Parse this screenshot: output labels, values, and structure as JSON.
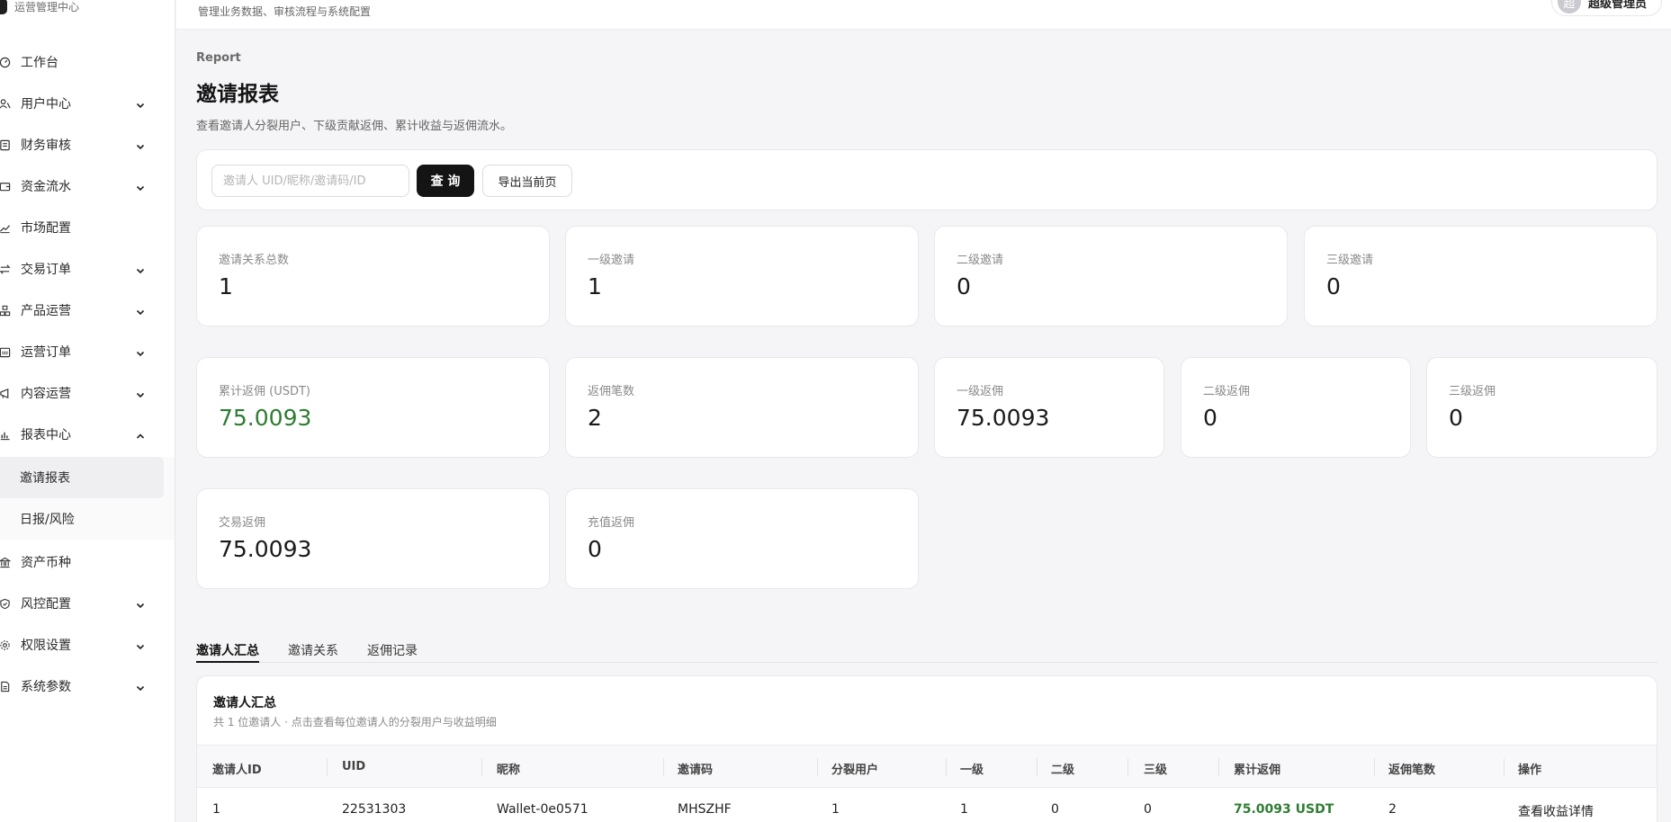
{
  "brand": {
    "subtitle": "运营管理中心"
  },
  "header": {
    "subtitle": "管理业务数据、审核流程与系统配置",
    "user_initial": "超",
    "user_name": "超级管理员"
  },
  "sidebar": {
    "items": [
      {
        "label": "工作台",
        "icon": "dashboard-icon",
        "chevron": "none"
      },
      {
        "label": "用户中心",
        "icon": "users-icon",
        "chevron": "down"
      },
      {
        "label": "财务审核",
        "icon": "audit-icon",
        "chevron": "down"
      },
      {
        "label": "资金流水",
        "icon": "wallet-icon",
        "chevron": "down"
      },
      {
        "label": "市场配置",
        "icon": "trend-icon",
        "chevron": "none"
      },
      {
        "label": "交易订单",
        "icon": "swap-icon",
        "chevron": "down"
      },
      {
        "label": "产品运营",
        "icon": "product-icon",
        "chevron": "down"
      },
      {
        "label": "运营订单",
        "icon": "calendar-icon",
        "chevron": "down"
      },
      {
        "label": "内容运营",
        "icon": "megaphone-icon",
        "chevron": "down"
      },
      {
        "label": "报表中心",
        "icon": "bar-chart-icon",
        "chevron": "up"
      }
    ],
    "sub_items": [
      {
        "label": "邀请报表",
        "active": true
      },
      {
        "label": "日报/风险",
        "active": false
      }
    ],
    "items_after": [
      {
        "label": "资产币种",
        "icon": "bank-icon",
        "chevron": "none"
      },
      {
        "label": "风控配置",
        "icon": "shield-icon",
        "chevron": "down"
      },
      {
        "label": "权限设置",
        "icon": "gear-icon",
        "chevron": "down"
      },
      {
        "label": "系统参数",
        "icon": "document-icon",
        "chevron": "down"
      }
    ]
  },
  "page": {
    "eyebrow": "Report",
    "title": "邀请报表",
    "description": "查看邀请人分裂用户、下级贡献返佣、累计收益与返佣流水。"
  },
  "filter": {
    "placeholder": "邀请人 UID/昵称/邀请码/ID",
    "query_label": "查 询",
    "export_label": "导出当前页"
  },
  "stats_row1": [
    {
      "label": "邀请关系总数",
      "value": "1"
    },
    {
      "label": "一级邀请",
      "value": "1"
    },
    {
      "label": "二级邀请",
      "value": "0"
    },
    {
      "label": "三级邀请",
      "value": "0"
    }
  ],
  "stats_row2": [
    {
      "label": "累计返佣 (USDT)",
      "value": "75.0093",
      "color": "#2e7d32"
    },
    {
      "label": "返佣笔数",
      "value": "2"
    },
    {
      "label": "一级返佣",
      "value": "75.0093"
    },
    {
      "label": "二级返佣",
      "value": "0"
    },
    {
      "label": "三级返佣",
      "value": "0"
    }
  ],
  "stats_row3": [
    {
      "label": "交易返佣",
      "value": "75.0093"
    },
    {
      "label": "充值返佣",
      "value": "0"
    }
  ],
  "tabs": [
    {
      "label": "邀请人汇总",
      "active": true
    },
    {
      "label": "邀请关系",
      "active": false
    },
    {
      "label": "返佣记录",
      "active": false
    }
  ],
  "table": {
    "title": "邀请人汇总",
    "subtitle": "共 1 位邀请人 · 点击查看每位邀请人的分裂用户与收益明细",
    "columns": [
      "邀请人ID",
      "UID",
      "昵称",
      "邀请码",
      "分裂用户",
      "一级",
      "二级",
      "三级",
      "累计返佣",
      "返佣笔数",
      "操作"
    ],
    "rows": [
      [
        "1",
        "22531303",
        "Wallet-0e0571",
        "MHSZHF",
        "1",
        "1",
        "0",
        "0",
        "75.0093 USDT",
        "2",
        "查看收益详情"
      ]
    ]
  }
}
